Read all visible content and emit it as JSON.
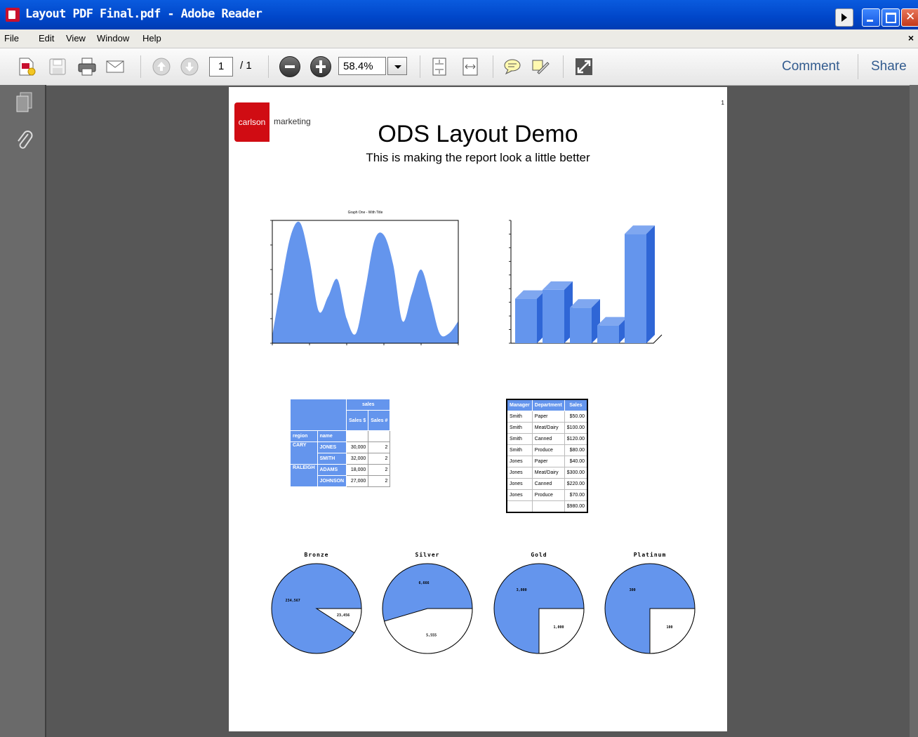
{
  "window": {
    "title": "Layout PDF Final.pdf - Adobe Reader"
  },
  "menu": {
    "items": [
      "File",
      "Edit",
      "View",
      "Window",
      "Help"
    ],
    "close_doc": "×"
  },
  "toolbar": {
    "page_current": "1",
    "page_total": "/ 1",
    "zoom": "58.4%",
    "comment_label": "Comment",
    "share_label": "Share",
    "icons": [
      "create-pdf-icon",
      "save-icon",
      "print-icon",
      "email-icon",
      "prev-page-icon",
      "next-page-icon",
      "zoom-out-icon",
      "zoom-in-icon",
      "fit-page-icon",
      "fit-width-icon",
      "comment-bubble-icon",
      "sign-icon",
      "fullscreen-icon"
    ]
  },
  "sidebar": {
    "icons": [
      "pages-icon",
      "attachment-icon"
    ]
  },
  "document": {
    "page_number": "1",
    "logo_red_text": "carlson",
    "logo_text": "marketing",
    "title": "ODS Layout Demo",
    "subtitle": "This is making the report look a little better",
    "accent": "#6495ed"
  },
  "chart_data": [
    {
      "type": "area",
      "title": "Graph One - With Title",
      "x": [
        0,
        1,
        2,
        3,
        4,
        5,
        6,
        7,
        8,
        9,
        10,
        11,
        12,
        13,
        14,
        15,
        16,
        17,
        18,
        19,
        20
      ],
      "series": [
        {
          "values": [
            0.3,
            2.5,
            4.4,
            4.9,
            3.4,
            1.3,
            1.9,
            2.6,
            1.0,
            0.4,
            2.2,
            4.2,
            4.4,
            3.2,
            0.9,
            2.0,
            3.0,
            1.8,
            0.4,
            0.4,
            0.9
          ]
        }
      ],
      "ylim": [
        0,
        5
      ]
    },
    {
      "type": "bar",
      "categories": [
        "",
        "",
        "",
        "",
        ""
      ],
      "values": [
        3.5,
        4.2,
        2.8,
        1.4,
        8.6
      ],
      "ylim": [
        0,
        9
      ]
    },
    {
      "type": "table",
      "spanning_header": "sales",
      "columns": [
        "region",
        "name",
        "Sales $",
        "Sales #"
      ],
      "rows": [
        [
          "CARY",
          "JONES",
          "30,000",
          "2"
        ],
        [
          "",
          "SMITH",
          "32,000",
          "2"
        ],
        [
          "RALEIGH",
          "ADAMS",
          "18,000",
          "2"
        ],
        [
          "",
          "JOHNSON",
          "27,000",
          "2"
        ]
      ]
    },
    {
      "type": "table",
      "columns": [
        "Manager",
        "Department",
        "Sales"
      ],
      "rows": [
        [
          "Smith",
          "Paper",
          "$50.00"
        ],
        [
          "Smith",
          "Meat/Dairy",
          "$100.00"
        ],
        [
          "Smith",
          "Canned",
          "$120.00"
        ],
        [
          "Smith",
          "Produce",
          "$80.00"
        ],
        [
          "Jones",
          "Paper",
          "$40.00"
        ],
        [
          "Jones",
          "Meat/Dairy",
          "$300.00"
        ],
        [
          "Jones",
          "Canned",
          "$220.00"
        ],
        [
          "Jones",
          "Produce",
          "$70.00"
        ],
        [
          "",
          "",
          "$980.00"
        ]
      ]
    },
    {
      "type": "pie",
      "title": "Bronze",
      "slices": [
        {
          "label": "234,567",
          "value": 234567
        },
        {
          "label": "23,456",
          "value": 23456
        }
      ]
    },
    {
      "type": "pie",
      "title": "Silver",
      "slices": [
        {
          "label": "6,666",
          "value": 6666
        },
        {
          "label": "5,555",
          "value": 5555
        }
      ]
    },
    {
      "type": "pie",
      "title": "Gold",
      "slices": [
        {
          "label": "3,000",
          "value": 3000
        },
        {
          "label": "1,000",
          "value": 1000
        }
      ]
    },
    {
      "type": "pie",
      "title": "Platinum",
      "slices": [
        {
          "label": "300",
          "value": 300
        },
        {
          "label": "100",
          "value": 100
        }
      ]
    }
  ]
}
